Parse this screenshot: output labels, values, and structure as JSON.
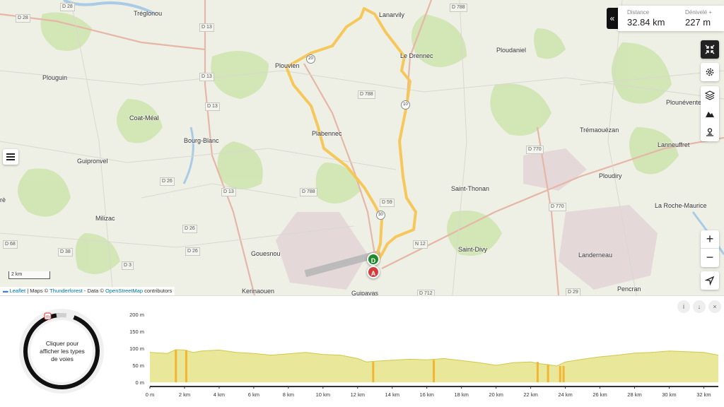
{
  "map": {
    "places": [
      {
        "label": "Tréglonou",
        "name": "place-treglonou"
      },
      {
        "label": "Lanarvily",
        "name": "place-lanarvily"
      },
      {
        "label": "Le Drennec",
        "name": "place-le-drennec"
      },
      {
        "label": "Ploudaniel",
        "name": "place-ploudaniel"
      },
      {
        "label": "Plouguin",
        "name": "place-plouguin"
      },
      {
        "label": "Plouvien",
        "name": "place-plouvien"
      },
      {
        "label": "Coat-Méal",
        "name": "place-coat-meal"
      },
      {
        "label": "Plabennec",
        "name": "place-plabennec"
      },
      {
        "label": "Bourg-Blanc",
        "name": "place-bourg-blanc"
      },
      {
        "label": "Guipronvel",
        "name": "place-guipronvel"
      },
      {
        "label": "Plounéventer",
        "name": "place-ploun-venter"
      },
      {
        "label": "Trémaouézan",
        "name": "place-tremaouezan"
      },
      {
        "label": "Lanneuffret",
        "name": "place-lanneuffret"
      },
      {
        "label": "Saint-Thonan",
        "name": "place-saint-thonan"
      },
      {
        "label": "Ploudiry",
        "name": "place-plouedern"
      },
      {
        "label": "La Roche-Maurice",
        "name": "place-la-roche-maurice"
      },
      {
        "label": "Milizac",
        "name": "place-milizac"
      },
      {
        "label": "Gouesnou",
        "name": "place-gouesnou"
      },
      {
        "label": "Saint-Divy",
        "name": "place-saint-divy"
      },
      {
        "label": "Landerneau",
        "name": "place-landerneau"
      },
      {
        "label": "Kerinaouen",
        "name": "place-kerinaouen"
      },
      {
        "label": "Pencran",
        "name": "place-pencran"
      },
      {
        "label": "Guipavas",
        "name": "place-guipavas"
      },
      {
        "label": "rè",
        "name": "place-re"
      }
    ],
    "shields": [
      "D 28",
      "D 28",
      "D 13",
      "D 13",
      "D 13",
      "D 13",
      "D 788",
      "D 788",
      "D 788",
      "D 770",
      "D 770",
      "D 26",
      "D 26",
      "D 26",
      "D 38",
      "D 3",
      "D 68",
      "D 59",
      "N 12",
      "D 29",
      "D 712"
    ],
    "route_numbers": [
      "20",
      "10",
      "30"
    ],
    "marker_start": "D",
    "marker_end": "A",
    "scale_label": "2 km",
    "attribution": {
      "leaflet": "Leaflet",
      "middle": " | Maps © ",
      "thunderforest": "Thunderforest",
      "data": " - Data © ",
      "osm": "OpenStreetMap",
      "tail": " contributors"
    }
  },
  "stats": {
    "distance_label": "Distance",
    "distance_value": "32.84 km",
    "elevation_label": "Dénivelé +",
    "elevation_value": "227 m"
  },
  "donut": {
    "text": "Cliquer pour afficher les types de voies",
    "badge": "m"
  },
  "profile": {
    "y_ticks": [
      "200 m",
      "150 m",
      "100 m",
      "50 m",
      "0 m"
    ],
    "x_ticks": [
      "0 m",
      "2 km",
      "4 km",
      "6 km",
      "8 km",
      "10 km",
      "12 km",
      "14 km",
      "16 km",
      "18 km",
      "20 km",
      "22 km",
      "24 km",
      "26 km",
      "28 km",
      "30 km",
      "32 km"
    ],
    "buttons": [
      "info",
      "download",
      "close"
    ],
    "colors": {
      "fill": "#e9e79a",
      "line": "#cfc94a",
      "slope": "#f2b632"
    }
  },
  "chart_data": {
    "type": "area",
    "x": [
      0,
      1,
      1.5,
      2,
      2.5,
      3,
      4,
      5,
      6,
      7,
      8,
      9,
      10,
      11,
      12,
      12.5,
      13,
      14,
      15,
      16,
      17,
      18,
      19,
      20,
      21,
      22,
      22.5,
      23,
      23.5,
      24,
      25,
      26,
      27,
      28,
      29,
      30,
      31,
      32,
      32.84
    ],
    "y": [
      88,
      85,
      96,
      95,
      88,
      92,
      95,
      88,
      85,
      80,
      84,
      88,
      82,
      80,
      70,
      60,
      62,
      65,
      68,
      66,
      70,
      64,
      58,
      50,
      58,
      60,
      55,
      52,
      48,
      60,
      68,
      75,
      80,
      86,
      88,
      92,
      90,
      88,
      80
    ],
    "ylim": [
      0,
      200
    ],
    "xlabel": "",
    "ylabel": ""
  },
  "toolbar": {
    "collapse": "«",
    "zoom_in": "+",
    "zoom_out": "−"
  }
}
